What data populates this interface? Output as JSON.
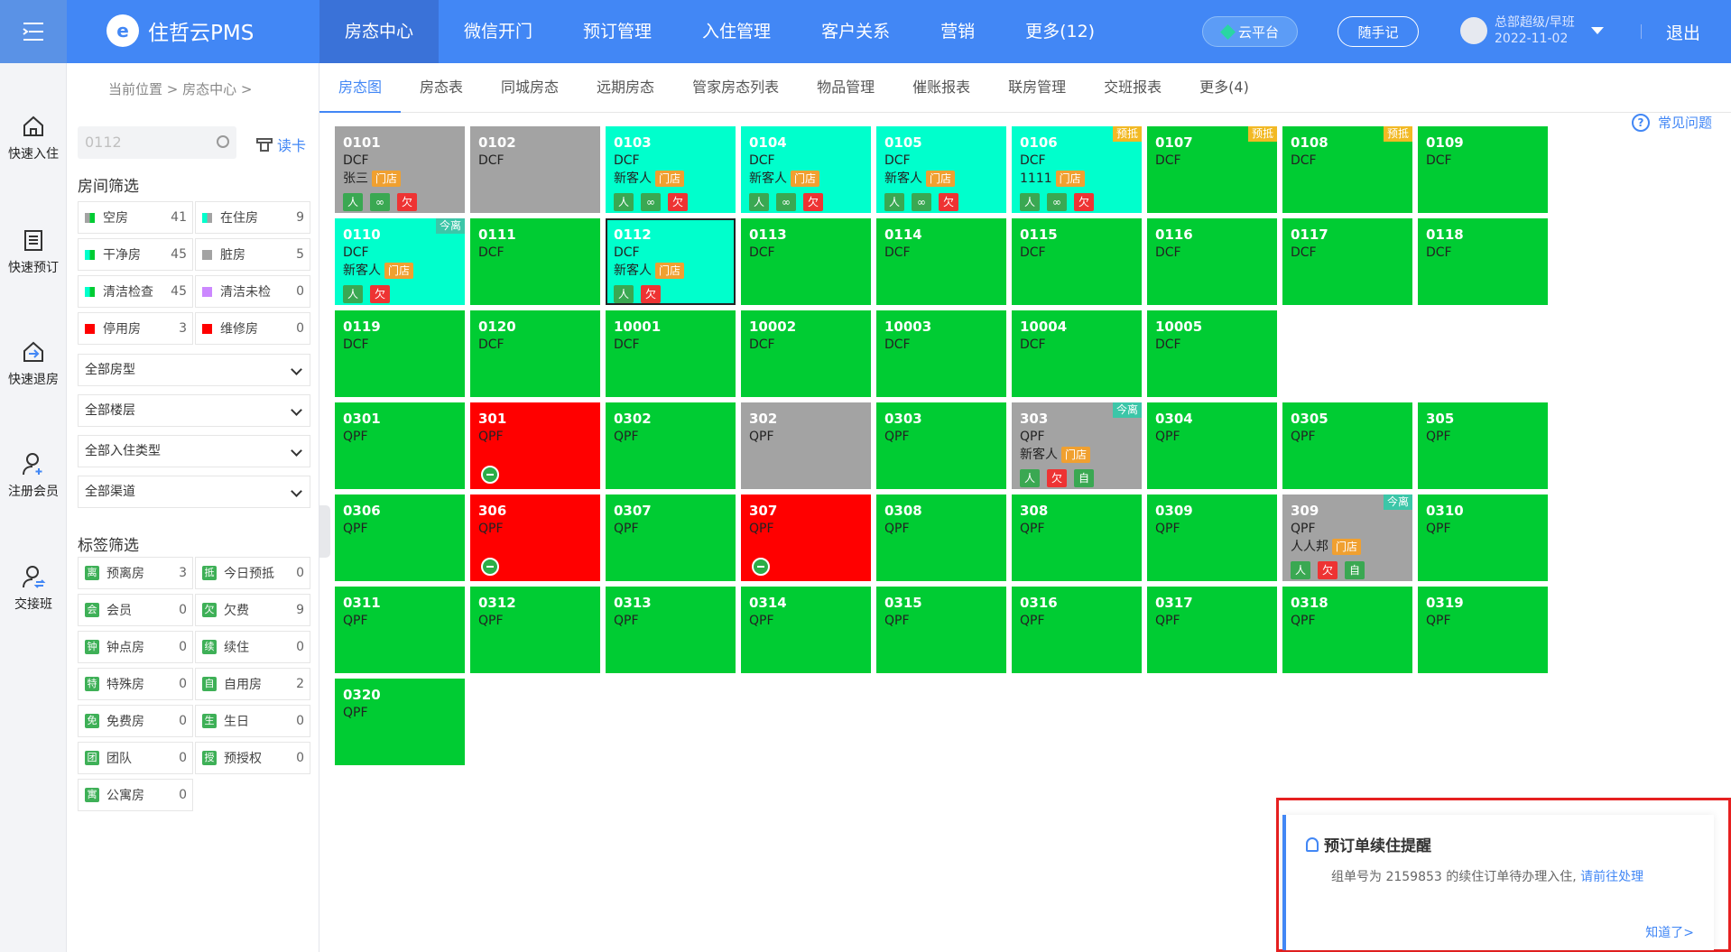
{
  "header": {
    "app_name": "住哲云PMS",
    "nav": [
      "房态中心",
      "微信开门",
      "预订管理",
      "入住管理",
      "客户关系",
      "营销",
      "更多(12)"
    ],
    "cloud_label": "云平台",
    "note_label": "随手记",
    "user_name": "总部超级/早班",
    "user_date": "2022-11-02",
    "logout": "退出"
  },
  "leftbar": [
    "快速入住",
    "快速预订",
    "快速退房",
    "注册会员",
    "交接班"
  ],
  "breadcrumb": "当前位置  >  房态中心  >",
  "search": {
    "placeholder": "0112",
    "readcard": "读卡"
  },
  "room_filter": {
    "title": "房间筛选",
    "items": [
      {
        "label": "空房",
        "count": "41",
        "color": "#a3a3a3",
        "color2": "#00cc33"
      },
      {
        "label": "在住房",
        "count": "9",
        "color": "#00ffcc",
        "color2": "#a3a3a3"
      },
      {
        "label": "干净房",
        "count": "45",
        "color": "#00ffcc",
        "color2": "#00cc33"
      },
      {
        "label": "脏房",
        "count": "5",
        "color": "#a3a3a3",
        "color2": "#a3a3a3"
      },
      {
        "label": "清洁检查",
        "count": "45",
        "color": "#00ffcc",
        "color2": "#00cc33"
      },
      {
        "label": "清洁未检",
        "count": "0",
        "color": "#cc88ff",
        "color2": "#cc88ff"
      },
      {
        "label": "停用房",
        "count": "3",
        "color": "#ff0000",
        "color2": "#ff0000"
      },
      {
        "label": "维修房",
        "count": "0",
        "color": "#ff0000",
        "color2": "#ff0000"
      }
    ]
  },
  "selects": [
    "全部房型",
    "全部楼层",
    "全部入住类型",
    "全部渠道"
  ],
  "tag_filter": {
    "title": "标签筛选",
    "items": [
      {
        "icon": "离",
        "label": "预离房",
        "count": "3"
      },
      {
        "icon": "抵",
        "label": "今日预抵",
        "count": "0"
      },
      {
        "icon": "会",
        "label": "会员",
        "count": "0"
      },
      {
        "icon": "欠",
        "label": "欠费",
        "count": "9"
      },
      {
        "icon": "钟",
        "label": "钟点房",
        "count": "0"
      },
      {
        "icon": "续",
        "label": "续住",
        "count": "0"
      },
      {
        "icon": "特",
        "label": "特殊房",
        "count": "0"
      },
      {
        "icon": "自",
        "label": "自用房",
        "count": "2"
      },
      {
        "icon": "免",
        "label": "免费房",
        "count": "0"
      },
      {
        "icon": "生",
        "label": "生日",
        "count": "0"
      },
      {
        "icon": "团",
        "label": "团队",
        "count": "0"
      },
      {
        "icon": "授",
        "label": "预授权",
        "count": "0"
      },
      {
        "icon": "寓",
        "label": "公寓房",
        "count": "0"
      }
    ]
  },
  "tabs": [
    "房态图",
    "房态表",
    "同城房态",
    "远期房态",
    "管家房态列表",
    "物品管理",
    "催账报表",
    "联房管理",
    "交班报表",
    "更多(4)"
  ],
  "faq": "常见问题",
  "labels": {
    "mendian": "门店",
    "owe": "欠",
    "self": "自",
    "link": "∞",
    "person": "人"
  },
  "rooms": [
    {
      "num": "0101",
      "code": "DCF",
      "status": "grey",
      "guest": "张三",
      "icons": [
        "person",
        "link",
        "owe"
      ]
    },
    {
      "num": "0102",
      "code": "DCF",
      "status": "grey"
    },
    {
      "num": "0103",
      "code": "DCF",
      "status": "cyan",
      "guest": "新客人",
      "icons": [
        "person",
        "link",
        "owe"
      ]
    },
    {
      "num": "0104",
      "code": "DCF",
      "status": "cyan",
      "guest": "新客人",
      "icons": [
        "person",
        "link",
        "owe"
      ]
    },
    {
      "num": "0105",
      "code": "DCF",
      "status": "cyan",
      "guest": "新客人",
      "icons": [
        "person",
        "link",
        "owe"
      ]
    },
    {
      "num": "0106",
      "code": "DCF",
      "status": "cyan",
      "guest": "1111",
      "icons": [
        "person",
        "link",
        "owe"
      ],
      "badge": "预抵",
      "badge_color": "yellow"
    },
    {
      "num": "0107",
      "code": "DCF",
      "status": "green",
      "badge": "预抵",
      "badge_color": "yellow"
    },
    {
      "num": "0108",
      "code": "DCF",
      "status": "green",
      "badge": "预抵",
      "badge_color": "yellow"
    },
    {
      "num": "0109",
      "code": "DCF",
      "status": "green"
    },
    {
      "num": "0110",
      "code": "DCF",
      "status": "cyan",
      "guest": "新客人",
      "icons": [
        "person",
        "owe"
      ],
      "badge": "今离",
      "badge_color": "teal"
    },
    {
      "num": "0111",
      "code": "DCF",
      "status": "green"
    },
    {
      "num": "0112",
      "code": "DCF",
      "status": "cyan",
      "guest": "新客人",
      "icons": [
        "person",
        "owe"
      ],
      "selected": true
    },
    {
      "num": "0113",
      "code": "DCF",
      "status": "green"
    },
    {
      "num": "0114",
      "code": "DCF",
      "status": "green"
    },
    {
      "num": "0115",
      "code": "DCF",
      "status": "green"
    },
    {
      "num": "0116",
      "code": "DCF",
      "status": "green"
    },
    {
      "num": "0117",
      "code": "DCF",
      "status": "green"
    },
    {
      "num": "0118",
      "code": "DCF",
      "status": "green"
    },
    {
      "num": "0119",
      "code": "DCF",
      "status": "green"
    },
    {
      "num": "0120",
      "code": "DCF",
      "status": "green"
    },
    {
      "num": "10001",
      "code": "DCF",
      "status": "green"
    },
    {
      "num": "10002",
      "code": "DCF",
      "status": "green"
    },
    {
      "num": "10003",
      "code": "DCF",
      "status": "green"
    },
    {
      "num": "10004",
      "code": "DCF",
      "status": "green"
    },
    {
      "num": "10005",
      "code": "DCF",
      "status": "green"
    },
    {
      "blank": true
    },
    {
      "blank": true
    },
    {
      "num": "0301",
      "code": "QPF",
      "status": "green"
    },
    {
      "num": "301",
      "code": "QPF",
      "status": "red",
      "stop": true
    },
    {
      "num": "0302",
      "code": "QPF",
      "status": "green"
    },
    {
      "num": "302",
      "code": "QPF",
      "status": "grey"
    },
    {
      "num": "0303",
      "code": "QPF",
      "status": "green"
    },
    {
      "num": "303",
      "code": "QPF",
      "status": "grey",
      "guest": "新客人",
      "icons": [
        "person",
        "owe",
        "self"
      ],
      "badge": "今离",
      "badge_color": "teal"
    },
    {
      "num": "0304",
      "code": "QPF",
      "status": "green"
    },
    {
      "num": "0305",
      "code": "QPF",
      "status": "green"
    },
    {
      "num": "305",
      "code": "QPF",
      "status": "green"
    },
    {
      "num": "0306",
      "code": "QPF",
      "status": "green"
    },
    {
      "num": "306",
      "code": "QPF",
      "status": "red",
      "stop": true
    },
    {
      "num": "0307",
      "code": "QPF",
      "status": "green"
    },
    {
      "num": "307",
      "code": "QPF",
      "status": "red",
      "stop": true
    },
    {
      "num": "0308",
      "code": "QPF",
      "status": "green"
    },
    {
      "num": "308",
      "code": "QPF",
      "status": "green"
    },
    {
      "num": "0309",
      "code": "QPF",
      "status": "green"
    },
    {
      "num": "309",
      "code": "QPF",
      "status": "grey",
      "guest": "人人邦",
      "icons": [
        "person",
        "owe",
        "self"
      ],
      "badge": "今离",
      "badge_color": "teal"
    },
    {
      "num": "0310",
      "code": "QPF",
      "status": "green"
    },
    {
      "num": "0311",
      "code": "QPF",
      "status": "green"
    },
    {
      "num": "0312",
      "code": "QPF",
      "status": "green"
    },
    {
      "num": "0313",
      "code": "QPF",
      "status": "green"
    },
    {
      "num": "0314",
      "code": "QPF",
      "status": "green"
    },
    {
      "num": "0315",
      "code": "QPF",
      "status": "green"
    },
    {
      "num": "0316",
      "code": "QPF",
      "status": "green"
    },
    {
      "num": "0317",
      "code": "QPF",
      "status": "green"
    },
    {
      "num": "0318",
      "code": "QPF",
      "status": "green"
    },
    {
      "num": "0319",
      "code": "QPF",
      "status": "green"
    },
    {
      "num": "0320",
      "code": "QPF",
      "status": "green"
    }
  ],
  "notice": {
    "title": "预订单续住提醒",
    "text": "组单号为 2159853 的续住订单待办理入住,",
    "link": "请前往处理",
    "ok": "知道了>"
  }
}
